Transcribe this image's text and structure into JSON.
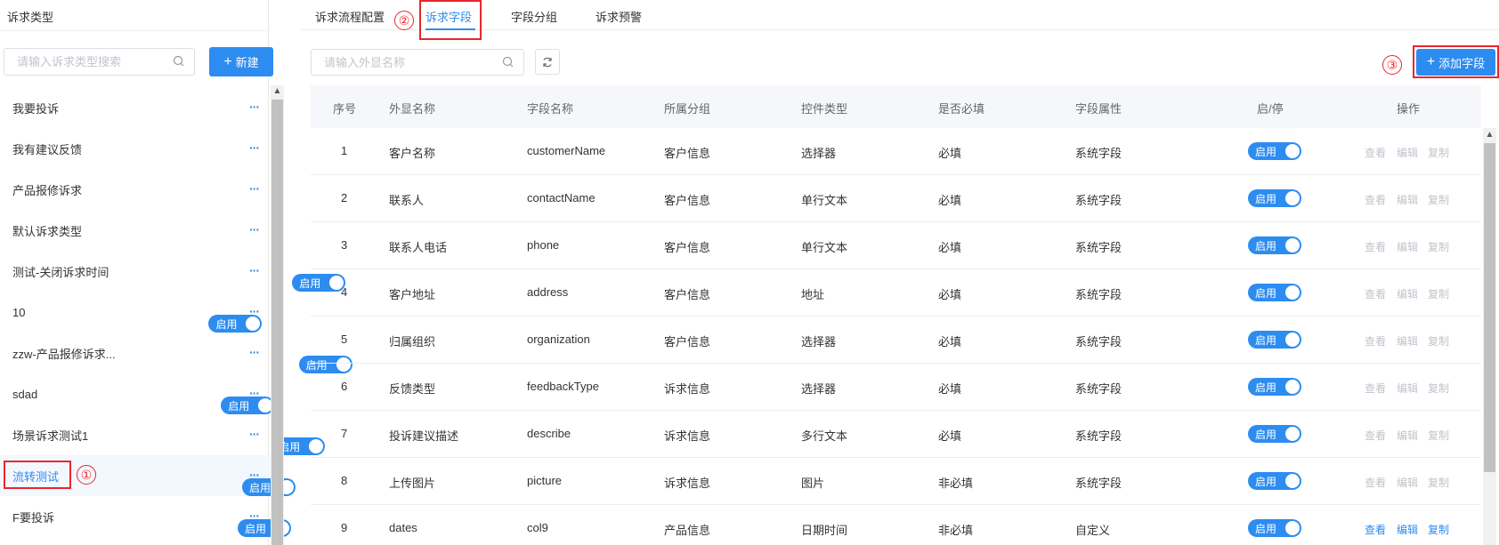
{
  "sidebar": {
    "title": "诉求类型",
    "search_placeholder": "请输入诉求类型搜索",
    "new_button": "新建",
    "items": [
      {
        "label": "我要投诉",
        "toggle": null
      },
      {
        "label": "我有建议反馈",
        "toggle": null
      },
      {
        "label": "产品报修诉求",
        "toggle": null
      },
      {
        "label": "默认诉求类型",
        "toggle": null
      },
      {
        "label": "测试-关闭诉求时间",
        "toggle": "启用"
      },
      {
        "label": "10",
        "toggle": "启用"
      },
      {
        "label": "zzw-产品报修诉求...",
        "toggle": "启用"
      },
      {
        "label": "sdad",
        "toggle": "启用"
      },
      {
        "label": "场景诉求测试1",
        "toggle": "启用"
      },
      {
        "label": "流转测试",
        "toggle": "启用"
      },
      {
        "label": "F要投诉",
        "toggle": "启用"
      }
    ],
    "active_index": 9,
    "more_icon": "ellipsis-icon"
  },
  "tabs": [
    "诉求流程配置",
    "诉求字段",
    "字段分组",
    "诉求预警"
  ],
  "active_tab": 1,
  "toolbar": {
    "search_placeholder": "请输入外显名称",
    "add_button": "添加字段"
  },
  "markers": [
    "①",
    "②",
    "③"
  ],
  "table": {
    "columns": [
      "序号",
      "外显名称",
      "字段名称",
      "所属分组",
      "控件类型",
      "是否必填",
      "字段属性",
      "启/停",
      "操作"
    ],
    "rows": [
      {
        "no": "1",
        "display": "客户名称",
        "field": "customerName",
        "group": "客户信息",
        "control": "选择器",
        "required": "必填",
        "attr": "系统字段",
        "status": "启用",
        "ops_enabled": false
      },
      {
        "no": "2",
        "display": "联系人",
        "field": "contactName",
        "group": "客户信息",
        "control": "单行文本",
        "required": "必填",
        "attr": "系统字段",
        "status": "启用",
        "ops_enabled": false
      },
      {
        "no": "3",
        "display": "联系人电话",
        "field": "phone",
        "group": "客户信息",
        "control": "单行文本",
        "required": "必填",
        "attr": "系统字段",
        "status": "启用",
        "ops_enabled": false
      },
      {
        "no": "4",
        "display": "客户地址",
        "field": "address",
        "group": "客户信息",
        "control": "地址",
        "required": "必填",
        "attr": "系统字段",
        "status": "启用",
        "ops_enabled": false
      },
      {
        "no": "5",
        "display": "归属组织",
        "field": "organization",
        "group": "客户信息",
        "control": "选择器",
        "required": "必填",
        "attr": "系统字段",
        "status": "启用",
        "ops_enabled": false
      },
      {
        "no": "6",
        "display": "反馈类型",
        "field": "feedbackType",
        "group": "诉求信息",
        "control": "选择器",
        "required": "必填",
        "attr": "系统字段",
        "status": "启用",
        "ops_enabled": false
      },
      {
        "no": "7",
        "display": "投诉建议描述",
        "field": "describe",
        "group": "诉求信息",
        "control": "多行文本",
        "required": "必填",
        "attr": "系统字段",
        "status": "启用",
        "ops_enabled": false
      },
      {
        "no": "8",
        "display": "上传图片",
        "field": "picture",
        "group": "诉求信息",
        "control": "图片",
        "required": "非必填",
        "attr": "系统字段",
        "status": "启用",
        "ops_enabled": false
      },
      {
        "no": "9",
        "display": "dates",
        "field": "col9",
        "group": "产品信息",
        "control": "日期时间",
        "required": "非必填",
        "attr": "自定义",
        "status": "启用",
        "ops_enabled": true
      }
    ],
    "ops": [
      "查看",
      "编辑",
      "复制"
    ]
  },
  "colors": {
    "primary": "#2d8cf0",
    "marker": "#e8262c"
  }
}
